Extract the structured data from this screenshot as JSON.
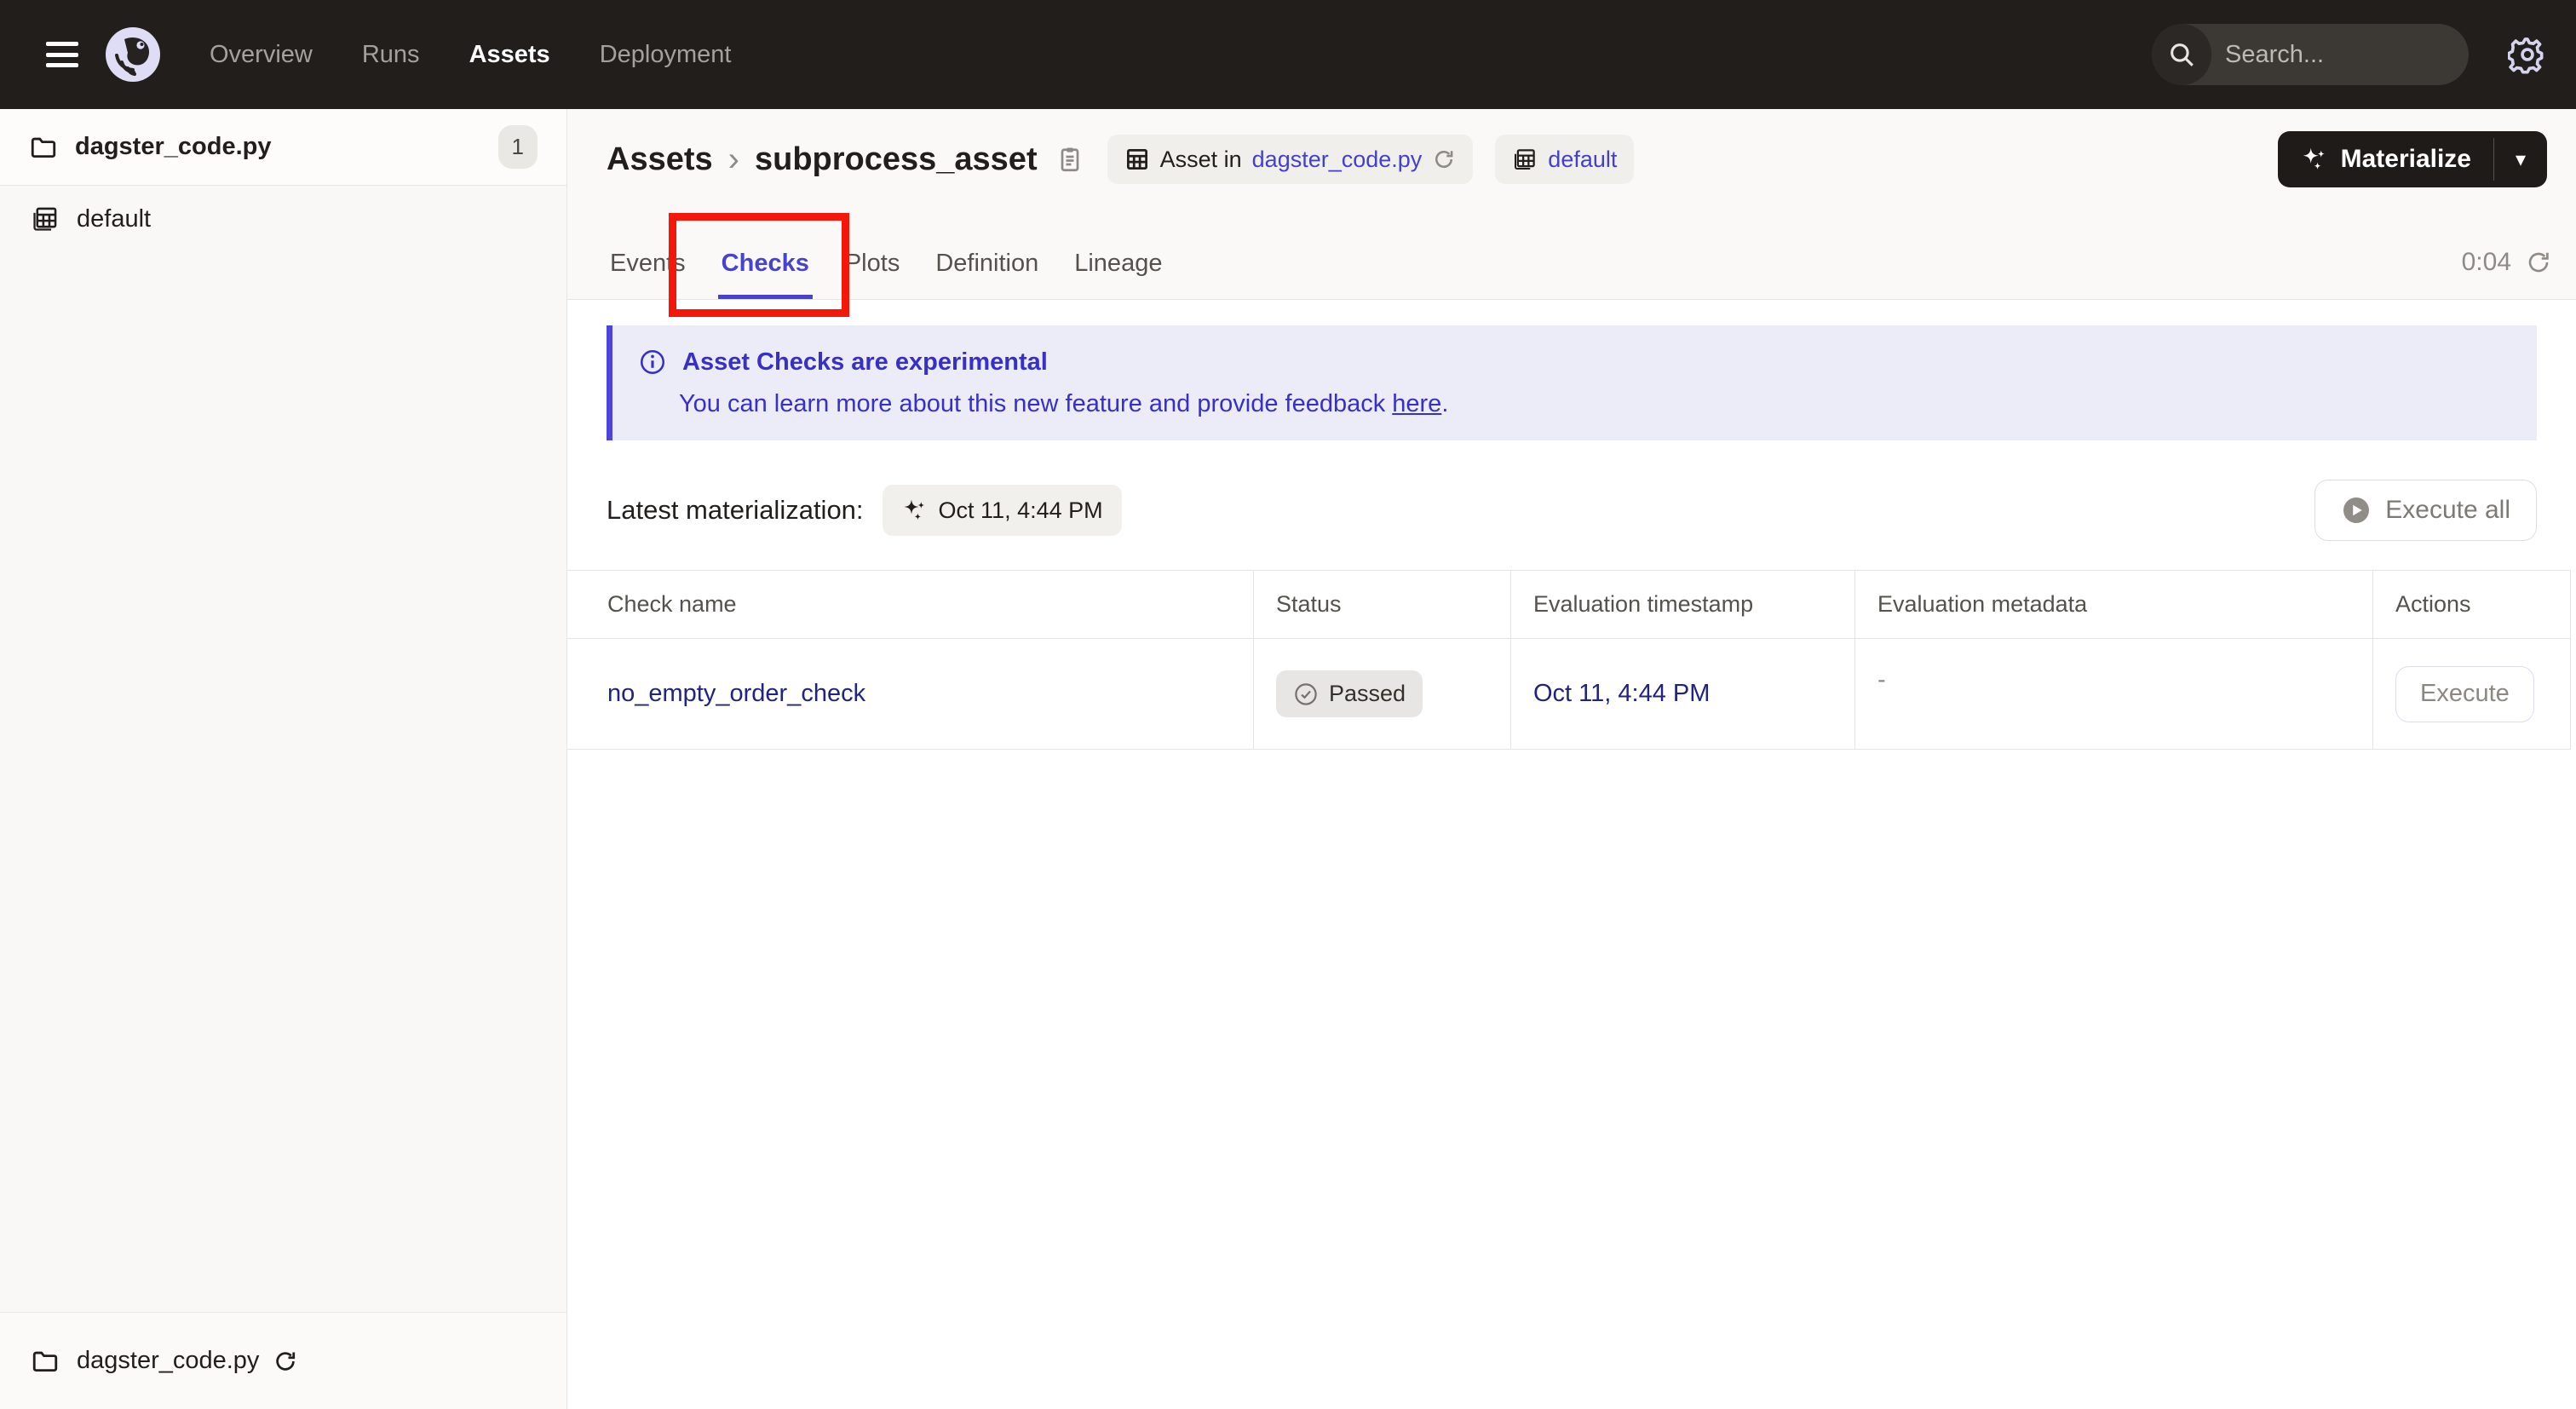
{
  "topnav": {
    "nav_items": [
      {
        "label": "Overview",
        "active": false
      },
      {
        "label": "Runs",
        "active": false
      },
      {
        "label": "Assets",
        "active": true
      },
      {
        "label": "Deployment",
        "active": false
      }
    ],
    "search": {
      "placeholder": "Search...",
      "shortcut": "/"
    }
  },
  "sidebar": {
    "repo": {
      "label": "dagster_code.py",
      "count": "1"
    },
    "items": [
      {
        "label": "default"
      }
    ],
    "footer": {
      "label": "dagster_code.py"
    }
  },
  "header": {
    "breadcrumb": {
      "root": "Assets",
      "separator": "›",
      "current": "subprocess_asset"
    },
    "asset_tag": {
      "prefix": "Asset in",
      "link": "dagster_code.py"
    },
    "group_tag": {
      "label": "default"
    },
    "materialize_label": "Materialize",
    "caret": "▾",
    "tabs": [
      {
        "label": "Events",
        "active": false
      },
      {
        "label": "Checks",
        "active": true
      },
      {
        "label": "Plots",
        "active": false
      },
      {
        "label": "Definition",
        "active": false
      },
      {
        "label": "Lineage",
        "active": false
      }
    ],
    "timer": "0:04"
  },
  "banner": {
    "title": "Asset Checks are experimental",
    "body_before": "You can learn more about this new feature and provide feedback ",
    "link_label": "here",
    "link_suffix": "."
  },
  "materialization": {
    "label": "Latest materialization:",
    "timestamp": "Oct 11, 4:44 PM",
    "execute_all_label": "Execute all"
  },
  "table": {
    "columns": [
      "Check name",
      "Status",
      "Evaluation timestamp",
      "Evaluation metadata",
      "Actions"
    ],
    "rows": [
      {
        "name": "no_empty_order_check",
        "status": "Passed",
        "timestamp": "Oct 11, 4:44 PM",
        "metadata": "-",
        "action": "Execute"
      }
    ]
  },
  "colors": {
    "accent_blurple": "#4F43DD",
    "annotation_red": "#F5170A",
    "link_navy": "#21237F",
    "topnav_bg": "#221E1C",
    "banner_bg": "#ECEBF8"
  }
}
